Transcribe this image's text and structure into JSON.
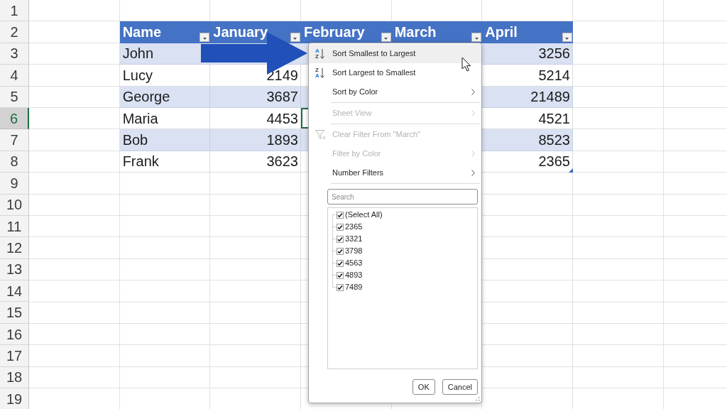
{
  "sheet": {
    "row_headers": [
      {
        "label": "1",
        "selected": false
      },
      {
        "label": "2",
        "selected": false
      },
      {
        "label": "3",
        "selected": false
      },
      {
        "label": "4",
        "selected": false
      },
      {
        "label": "5",
        "selected": false
      },
      {
        "label": "6",
        "selected": true
      },
      {
        "label": "7",
        "selected": false
      },
      {
        "label": "8",
        "selected": false
      },
      {
        "label": "9",
        "selected": false
      },
      {
        "label": "10",
        "selected": false
      },
      {
        "label": "11",
        "selected": false
      },
      {
        "label": "12",
        "selected": false
      },
      {
        "label": "13",
        "selected": false
      },
      {
        "label": "14",
        "selected": false
      },
      {
        "label": "15",
        "selected": false
      },
      {
        "label": "16",
        "selected": false
      },
      {
        "label": "17",
        "selected": false
      },
      {
        "label": "18",
        "selected": false
      },
      {
        "label": "19",
        "selected": false
      }
    ]
  },
  "table": {
    "columns": [
      {
        "label": "Name",
        "kind": "text",
        "has_active_cell": false
      },
      {
        "label": "January",
        "kind": "number",
        "has_active_cell": false
      },
      {
        "label": "February",
        "kind": "number",
        "has_active_cell": true
      },
      {
        "label": "March",
        "kind": "number",
        "has_active_cell": false
      },
      {
        "label": "April",
        "kind": "number",
        "has_active_cell": false
      }
    ],
    "rows": [
      {
        "cells": [
          "John",
          null,
          null,
          null,
          "3256"
        ]
      },
      {
        "cells": [
          "Lucy",
          "2149",
          null,
          null,
          "5214"
        ]
      },
      {
        "cells": [
          "George",
          "3687",
          null,
          null,
          "21489"
        ]
      },
      {
        "cells": [
          "Maria",
          "4453",
          null,
          null,
          "4521"
        ]
      },
      {
        "cells": [
          "Bob",
          "1893",
          null,
          null,
          "8523"
        ]
      },
      {
        "cells": [
          "Frank",
          "3623",
          null,
          null,
          "2365"
        ]
      }
    ]
  },
  "filter_menu": {
    "items": [
      {
        "kind": "ascending",
        "label": "Sort Smallest to Largest",
        "icon_letters": [
          "A",
          "Z"
        ],
        "highlighted": true,
        "disabled": false
      },
      {
        "kind": "descending",
        "label": "Sort Largest to Smallest",
        "icon_letters": [
          "Z",
          "A"
        ],
        "highlighted": false,
        "disabled": false
      },
      {
        "kind": "submenu",
        "label": "Sort by Color",
        "highlighted": false,
        "disabled": false
      },
      {
        "kind": "separator"
      },
      {
        "kind": "submenu",
        "label": "Sheet View",
        "highlighted": false,
        "disabled": true
      },
      {
        "kind": "separator"
      },
      {
        "kind": "clear",
        "label": "Clear Filter From \"March\"",
        "highlighted": false,
        "disabled": true
      },
      {
        "kind": "submenu",
        "label": "Filter by Color",
        "highlighted": false,
        "disabled": true
      },
      {
        "kind": "submenu",
        "label": "Number Filters",
        "highlighted": false,
        "disabled": false
      },
      {
        "kind": "separator"
      }
    ],
    "search": {
      "placeholder": "Search"
    },
    "values": [
      {
        "label": "(Select All)",
        "checked": true
      },
      {
        "label": "2365",
        "checked": true
      },
      {
        "label": "3321",
        "checked": true
      },
      {
        "label": "3798",
        "checked": true
      },
      {
        "label": "4563",
        "checked": true
      },
      {
        "label": "4893",
        "checked": true
      },
      {
        "label": "7489",
        "checked": true
      }
    ],
    "buttons": [
      {
        "label": "OK"
      },
      {
        "label": "Cancel"
      }
    ]
  }
}
